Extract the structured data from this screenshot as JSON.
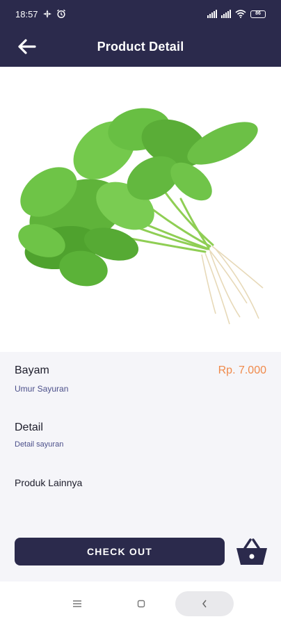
{
  "status": {
    "time": "18:57",
    "battery": "86"
  },
  "header": {
    "title": "Product Detail",
    "back_icon": "arrow-left-icon"
  },
  "product": {
    "name": "Bayam",
    "price": "Rp. 7.000",
    "age_label": "Umur Sayuran",
    "detail_heading": "Detail",
    "detail_text": "Detail sayuran",
    "other_heading": "Produk Lainnya",
    "image": "spinach-bunch"
  },
  "actions": {
    "checkout_label": "CHECK OUT",
    "basket_icon": "shopping-basket-icon"
  },
  "colors": {
    "primary": "#2b2a4c",
    "price": "#f08a4b",
    "subtext": "#4b4f8a",
    "panel_bg": "#f5f5f9"
  },
  "nav": {
    "menu_icon": "menu-icon",
    "home_icon": "home-square-icon",
    "back_icon": "chevron-left-icon"
  }
}
